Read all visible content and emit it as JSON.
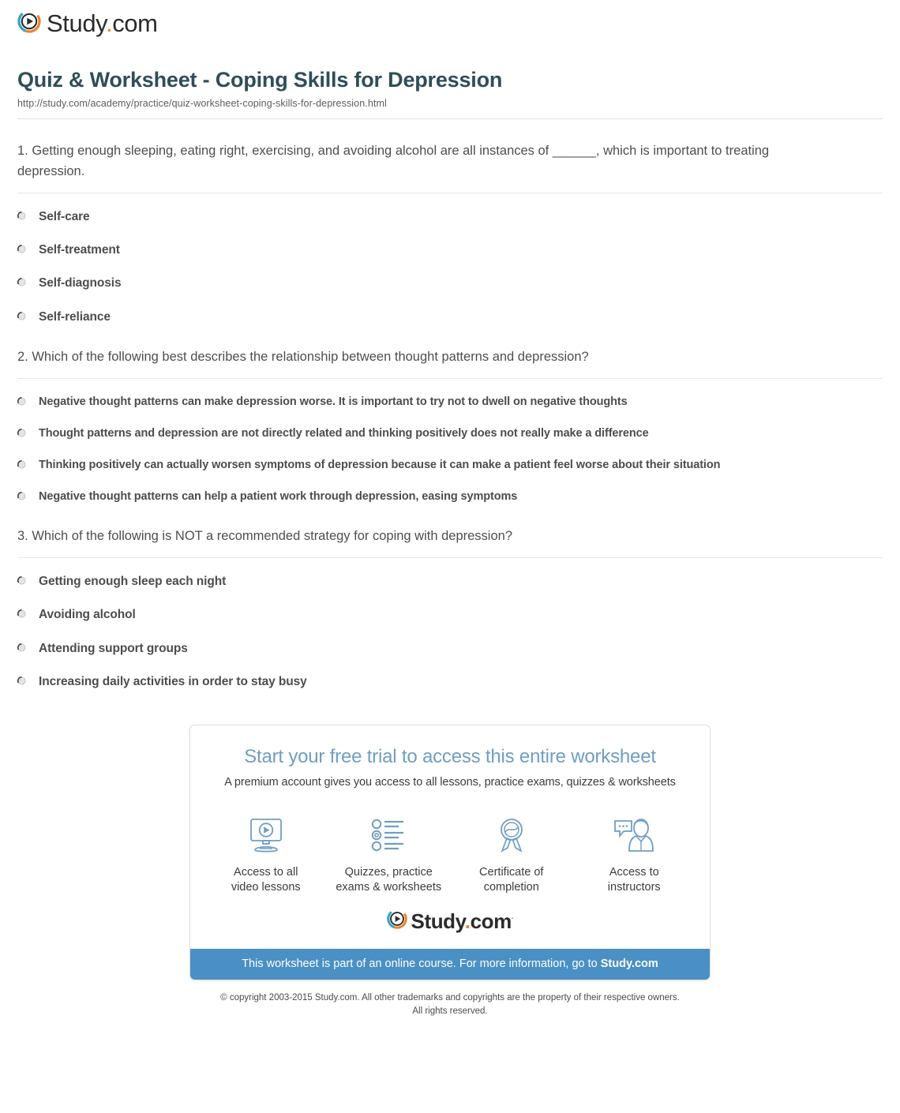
{
  "brand": {
    "name_main": "Study",
    "name_dot": ".",
    "name_suffix": "com",
    "trademark": "·",
    "logo_icon": "play-circle-icon",
    "orange": "#e8832a",
    "teal": "#2fa8c8",
    "title_color": "#2e4e59",
    "cta_blue": "#4a90c4"
  },
  "header": {
    "title": "Quiz & Worksheet - Coping Skills for Depression",
    "url": "http://study.com/academy/practice/quiz-worksheet-coping-skills-for-depression.html"
  },
  "questions": [
    {
      "number": "1.",
      "text": "1. Getting enough sleeping, eating right, exercising, and avoiding alcohol are all instances of ______, which is important to treating depression.",
      "options": [
        "Self-care",
        "Self-treatment",
        "Self-diagnosis",
        "Self-reliance"
      ]
    },
    {
      "number": "2.",
      "text": "2. Which of the following best describes the relationship between thought patterns and depression?",
      "options": [
        "Negative thought patterns can make depression worse. It is important to try not to dwell on negative thoughts",
        "Thought patterns and depression are not directly related and thinking positively does not really make a difference",
        "Thinking positively can actually worsen symptoms of depression because it can make a patient feel worse about their situation",
        "Negative thought patterns can help a patient work through depression, easing symptoms"
      ]
    },
    {
      "number": "3.",
      "text": "3. Which of the following is NOT a recommended strategy for coping with depression?",
      "options": [
        "Getting enough sleep each night",
        "Avoiding alcohol",
        "Attending support groups",
        "Increasing daily activities in order to stay busy"
      ]
    }
  ],
  "promo": {
    "headline": "Start your free trial to access this entire worksheet",
    "subhead": "A premium account gives you access to all lessons, practice exams, quizzes & worksheets",
    "features": [
      {
        "icon": "monitor-play-icon",
        "label": "Access to all\nvideo lessons"
      },
      {
        "icon": "checklist-icon",
        "label": "Quizzes, practice\nexams & worksheets"
      },
      {
        "icon": "award-ribbon-icon",
        "label": "Certificate of\ncompletion"
      },
      {
        "icon": "instructor-chat-icon",
        "label": "Access to\ninstructors"
      }
    ],
    "cta_prefix": "This worksheet is part of an online course. For more information, go to ",
    "cta_link": "Study.com"
  },
  "footer": {
    "line1": "© copyright 2003-2015 Study.com. All other trademarks and copyrights are the property of their respective owners.",
    "line2": "All rights reserved."
  }
}
